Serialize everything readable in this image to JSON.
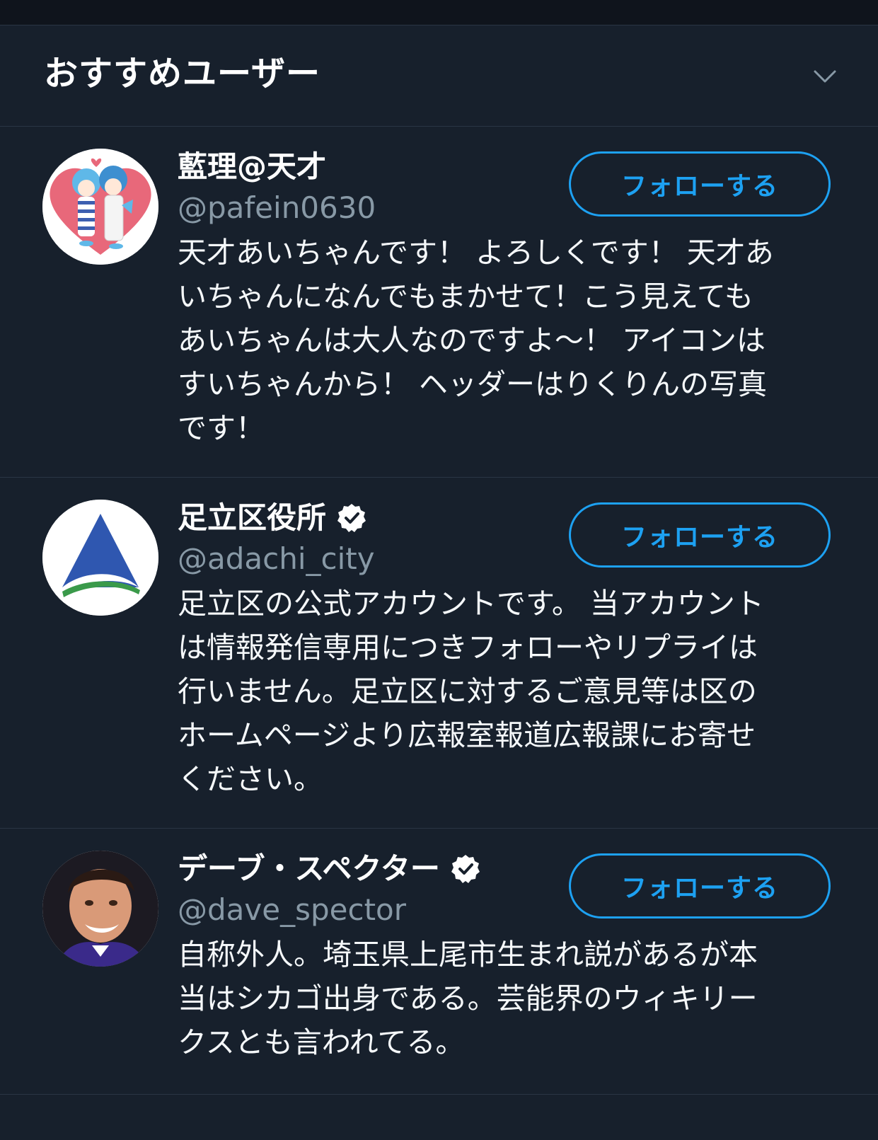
{
  "header": {
    "title": "おすすめユーザー",
    "collapse_icon": "chevron-down-icon"
  },
  "colors": {
    "background": "#17202c",
    "accent": "#1da1f2",
    "secondary_text": "#8899a6",
    "divider": "#2a3544"
  },
  "users": [
    {
      "display_name": "藍理@天才",
      "handle": "@pafein0630",
      "verified": false,
      "bio": "天才あいちゃんです！ よろしくです！ 天才あ\nいちゃんになんでもまかせて！こう見えても\nあいちゃんは大人なのですよ〜！ アイコンは\nすいちゃんから！ ヘッダーはりくりんの写真\nです！",
      "follow_label": "フォローする"
    },
    {
      "display_name": "足立区役所",
      "handle": "@adachi_city",
      "verified": true,
      "bio": "足立区の公式アカウントです。 当アカウント\nは情報発信専用につきフォローやリプライは\n行いません。足立区に対するご意見等は区の\nホームページより広報室報道広報課にお寄せ\nください。",
      "follow_label": "フォローする"
    },
    {
      "display_name": "デーブ・スペクター",
      "handle": "@dave_spector",
      "verified": true,
      "bio": "自称外人。埼玉県上尾市生まれ説があるが本\n当はシカゴ出身である。芸能界のウィキリー\nクスとも言われてる。",
      "follow_label": "フォローする"
    }
  ]
}
